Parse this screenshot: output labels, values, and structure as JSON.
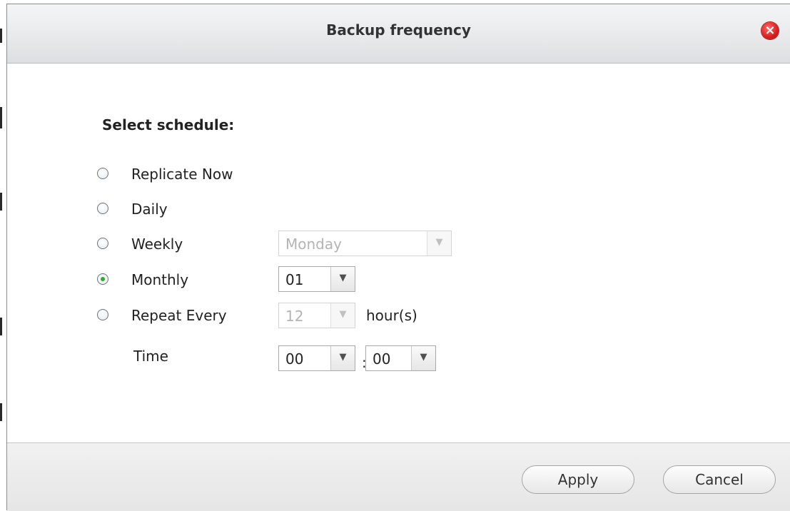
{
  "dialog": {
    "title": "Backup frequency",
    "close_symbol": "×"
  },
  "schedule": {
    "heading": "Select schedule:",
    "options": [
      {
        "label": "Replicate Now",
        "selected": false
      },
      {
        "label": "Daily",
        "selected": false
      },
      {
        "label": "Weekly",
        "selected": false
      },
      {
        "label": "Monthly",
        "selected": true
      },
      {
        "label": "Repeat Every",
        "selected": false
      }
    ],
    "weekly_day": {
      "value": "Monday",
      "disabled": true
    },
    "monthly_day": {
      "value": "01",
      "disabled": false
    },
    "repeat_hours": {
      "value": "12",
      "disabled": true,
      "unit": "hour(s)"
    },
    "time": {
      "label": "Time",
      "hour": "00",
      "separator": ":",
      "minute": "00"
    }
  },
  "footer": {
    "apply_label": "Apply",
    "cancel_label": "Cancel"
  },
  "icons": {
    "dropdown_arrow": "chevron-down-icon",
    "close": "close-icon"
  },
  "colors": {
    "radio_checked": "#2fa82f",
    "close_button": "#d91f1f"
  }
}
